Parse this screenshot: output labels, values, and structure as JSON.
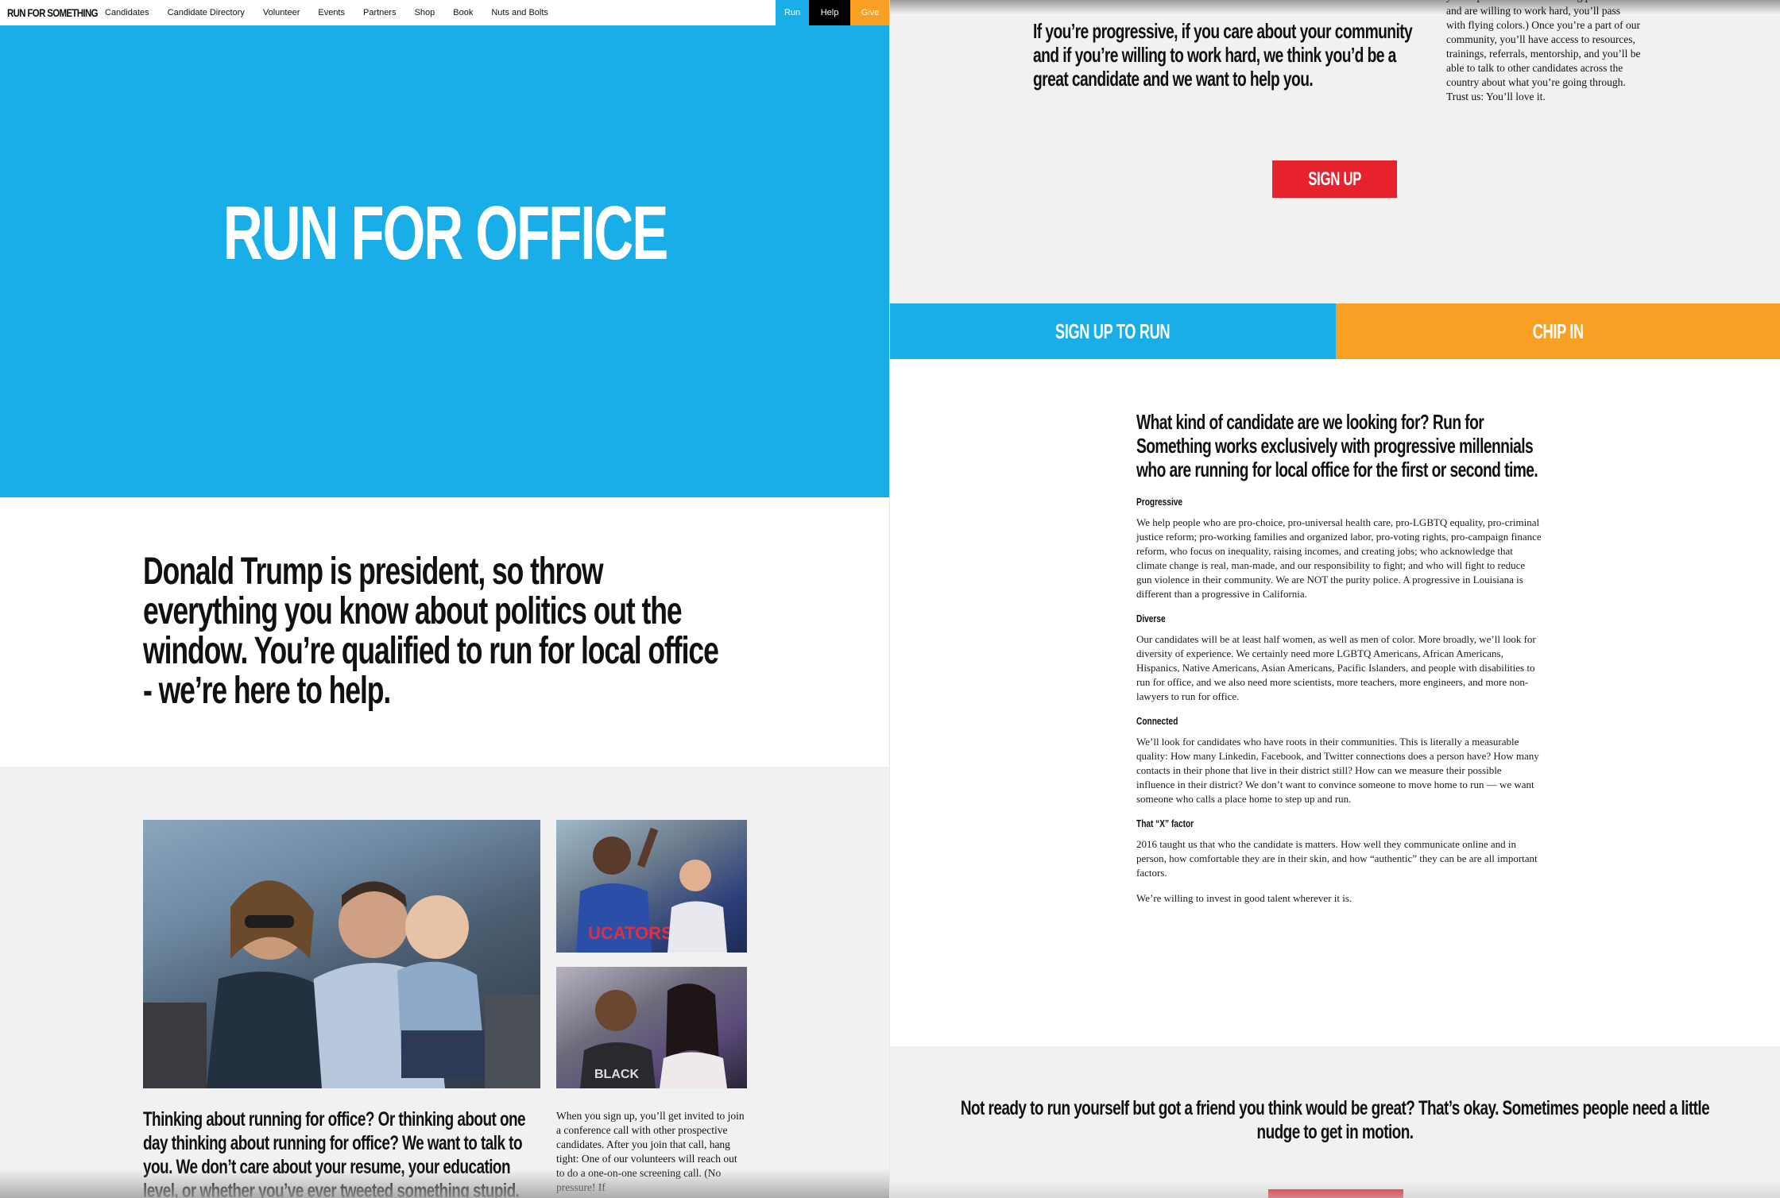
{
  "nav": {
    "logo": "RUN FOR SOMETHING",
    "links": [
      "Candidates",
      "Candidate Directory",
      "Volunteer",
      "Events",
      "Partners",
      "Shop",
      "Book",
      "Nuts and Bolts"
    ],
    "run": "Run",
    "help": "Help",
    "give": "Give"
  },
  "hero": {
    "title": "RUN FOR OFFICE"
  },
  "intro": "Donald Trump is president, so throw everything you know about politics out the window. You’re qualified to run for local office - we’re here to help.",
  "left_section": {
    "big_text": "Thinking about running for office? Or thinking about one day thinking about running for office? We want to talk to you. We don’t care about your resume, your education level, or whether you’ve ever tweeted something stupid.",
    "small_text": "When you sign up, you’ll get invited to join a conference call with other prospective candidates. After you join that call, hang tight: One of our volunteers will reach out to do a one-on-one screening call. (No pressure! If"
  },
  "right_top": {
    "big_text": "If you’re progressive, if you care about your community and if you’re willing to work hard, we think you’d be a great candidate and we want to help you.",
    "small_text": "you’re passionate about solving problems and are willing to work hard, you’ll pass with flying colors.) Once you’re a part of our community, you’ll have access to resources, trainings, referrals, mentorship, and you’ll be able to talk to other candidates across the country about what you’re going through. Trust us: You’ll love it.",
    "signup_button": "SIGN UP"
  },
  "cta": {
    "run": "SIGN UP TO RUN",
    "chip": "CHIP IN"
  },
  "criteria": {
    "heading": "What kind of candidate are we looking for? Run for Something works exclusively with progressive millennials who are running for local office for the first or second time.",
    "progressive_title": "Progressive",
    "progressive_text": "We help people who are pro-choice, pro-universal health care, pro-LGBTQ equality, pro-criminal justice reform; pro-working families and organized labor, pro-voting rights, pro-campaign finance reform, who focus on inequality, raising incomes, and creating jobs; who acknowledge that climate change is real, man-made, and our responsibility to fight; and who will fight to reduce gun violence in their community. We are NOT the purity police. A progressive in Louisiana is different than a progressive in California.",
    "diverse_title": "Diverse",
    "diverse_text": "Our candidates will be at least half women, as well as men of color. More broadly, we’ll look for diversity of experience. We certainly need more LGBTQ Americans, African Americans, Hispanics, Native Americans, Asian Americans, Pacific Islanders, and people with disabilities to run for office, and we also need more scientists, more teachers, more engineers, and more non-lawyers to run for office.",
    "connected_title": "Connected",
    "connected_text": "We’ll look for candidates who have roots in their communities. This is literally a measurable quality: How many Linkedin, Facebook, and Twitter connections does a person have? How many contacts in their phone that live in their district still? How can we measure their possible influence in their district? We don’t want to convince someone to move home to run — we want someone who calls a place home to step up and run.",
    "x_title": "That “X” factor",
    "x_text": "2016 taught us that who the candidate is matters. How well they communicate online and in person, how comfortable they are in their skin, and how “authentic” they can be are all important factors.",
    "invest_text": "We’re willing to invest in good talent wherever it is."
  },
  "bottom": {
    "text": "Not ready to run yourself but got a friend you think would be great? That’s okay. Sometimes people need a little nudge to get in motion."
  }
}
